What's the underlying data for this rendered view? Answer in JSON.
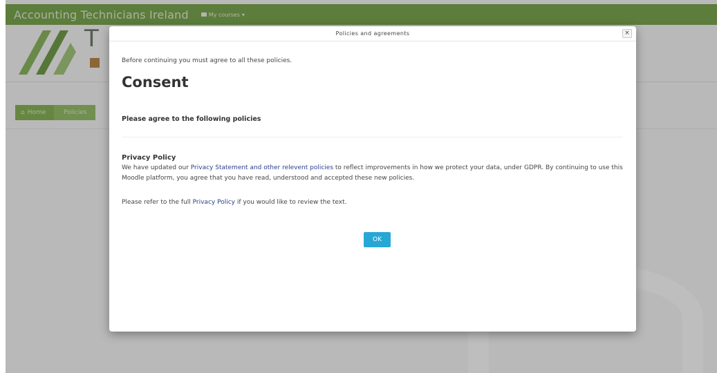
{
  "navbar": {
    "brand": "Accounting Technicians Ireland",
    "my_courses": "My courses"
  },
  "header": {
    "logo_text": "T"
  },
  "breadcrumb": {
    "home": "Home",
    "policies": "Policies"
  },
  "modal": {
    "title": "Policies and agreements",
    "close_label": "×",
    "intro": "Before continuing you must agree to all these policies.",
    "heading": "Consent",
    "agree_heading": "Please agree to the following policies",
    "policy": {
      "title": "Privacy Policy",
      "text_before_link": "We have updated our ",
      "link_text": "Privacy Statement and other relevent policies",
      "text_after_link": " to reflect improvements in how we protect your data, under GDPR. By continuing to use this Moodle platform, you agree that you have read, understood and accepted these new policies."
    },
    "refer": {
      "before": "Please refer to the full ",
      "link": "Privacy Policy",
      "after": " if you would like to review the text."
    },
    "ok_label": "OK"
  },
  "colors": {
    "navbar": "#6a9e35",
    "breadcrumb": "#79ae3f",
    "ok_button": "#27a7d6",
    "link": "#2a3f8f"
  }
}
